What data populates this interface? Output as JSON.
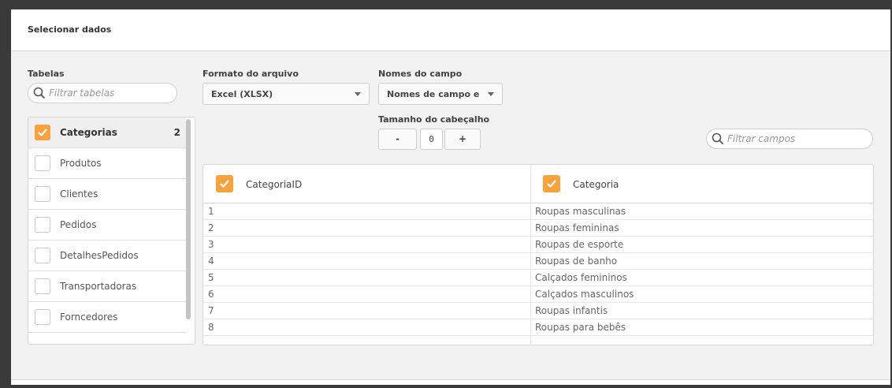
{
  "dialog": {
    "title": "Selecionar dados"
  },
  "tables": {
    "label": "Tabelas",
    "filter_placeholder": "Filtrar tabelas",
    "items": [
      {
        "name": "Categorias",
        "checked": true,
        "count": "2"
      },
      {
        "name": "Produtos",
        "checked": false
      },
      {
        "name": "Clientes",
        "checked": false
      },
      {
        "name": "Pedidos",
        "checked": false
      },
      {
        "name": "DetalhesPedidos",
        "checked": false
      },
      {
        "name": "Transportadoras",
        "checked": false
      },
      {
        "name": "Forncedores",
        "checked": false
      }
    ]
  },
  "file_format": {
    "label": "Formato do arquivo",
    "value": "Excel (XLSX)"
  },
  "field_names": {
    "label": "Nomes do campo",
    "value": "Nomes de campo e"
  },
  "header_size": {
    "label": "Tamanho do cabeçalho",
    "minus": "-",
    "value": "0",
    "plus": "+"
  },
  "fields": {
    "filter_placeholder": "Filtrar campos",
    "columns": [
      {
        "name": "CategoriaID",
        "checked": true
      },
      {
        "name": "Categoria",
        "checked": true
      }
    ],
    "rows": [
      [
        "1",
        "Roupas masculinas"
      ],
      [
        "2",
        "Roupas femininas"
      ],
      [
        "3",
        "Roupas de esporte"
      ],
      [
        "4",
        "Roupas de banho"
      ],
      [
        "5",
        "Calçados femininos"
      ],
      [
        "6",
        "Calçados masculinos"
      ],
      [
        "7",
        "Roupas infantis"
      ],
      [
        "8",
        "Roupas para bebês"
      ]
    ]
  },
  "colors": {
    "accent": "#f8a23e"
  },
  "icons": {
    "search": "search-icon",
    "check": "check-icon",
    "dropdown": "chevron-down-icon"
  }
}
